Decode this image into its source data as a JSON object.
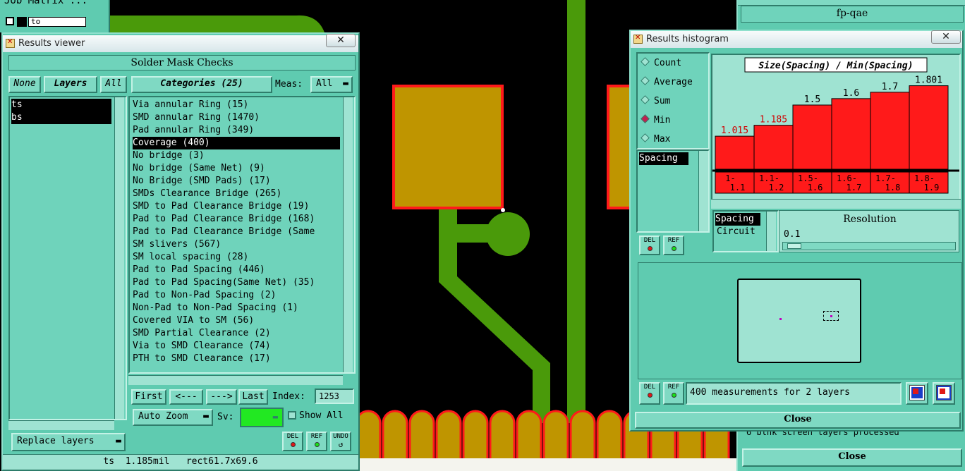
{
  "job_matrix": {
    "title": "Job Matrix ...",
    "layer_value": "to"
  },
  "results_viewer": {
    "title": "Results viewer",
    "section_title": "Solder Mask Checks",
    "filter_buttons": {
      "none": "None",
      "layers": "Layers",
      "all": "All"
    },
    "layers": [
      "ts",
      "bs"
    ],
    "categories_label": "Categories (25)",
    "meas_label": "Meas:",
    "meas_value": "All",
    "categories": [
      "Via annular Ring (15)",
      "SMD annular Ring (1470)",
      "Pad annular Ring (349)",
      "Coverage (400)",
      "No bridge (3)",
      "No bridge (Same Net) (9)",
      "No Bridge (SMD Pads) (17)",
      "SMDs Clearance Bridge (265)",
      "SMD to Pad Clearance Bridge (19)",
      "Pad to Pad Clearance Bridge (168)",
      "Pad to Pad Clearance Bridge (Same",
      "SM slivers (567)",
      "SM local spacing (28)",
      "Pad to Pad Spacing (446)",
      "Pad to Pad Spacing(Same Net) (35)",
      "Pad to Non-Pad Spacing (2)",
      "Non-Pad to Non-Pad Spacing (1)",
      "Covered VIA to SM (56)",
      "SMD Partial Clearance (2)",
      "Via to SMD Clearance (74)",
      "PTH to SMD Clearance (17)"
    ],
    "selected_category": "Coverage (400)",
    "nav": {
      "first": "First",
      "prev": "<---",
      "next": "--->",
      "last": "Last",
      "index_label": "Index:",
      "index_value": "1253"
    },
    "auto_zoom": "Auto Zoom",
    "sv_label": "Sv:",
    "show_all": "Show All",
    "replace_layers": "Replace layers",
    "status": "ts  1.185mil   rect61.7x69.6",
    "small_buttons": [
      "DEL",
      "REF",
      "UNDO"
    ]
  },
  "histogram": {
    "title": "Results histogram",
    "options": [
      "Count",
      "Average",
      "Sum",
      "Min",
      "Max"
    ],
    "selected_option": "Min",
    "list_item": "Spacing",
    "chart_title": "Size(Spacing) / Min(Spacing)",
    "resolution_label": "Resolution",
    "resolution_value": "0.1",
    "type_list": [
      "Spacing",
      "Circuit"
    ],
    "selected_type": "Spacing",
    "summary": "400 measurements for 2 layers",
    "close": "Close",
    "small_buttons": [
      "DEL",
      "REF"
    ]
  },
  "chart_data": {
    "type": "bar",
    "title": "Size(Spacing) / Min(Spacing)",
    "categories": [
      "1-1.1",
      "1.1-1.2",
      "1.5-1.6",
      "1.6-1.7",
      "1.7-1.8",
      "1.8-1.9"
    ],
    "category_lines": [
      [
        "1-",
        "1.1"
      ],
      [
        "1.1-",
        "1.2"
      ],
      [
        "1.5-",
        "1.6"
      ],
      [
        "1.6-",
        "1.7"
      ],
      [
        "1.7-",
        "1.8"
      ],
      [
        "1.8-",
        "1.9"
      ]
    ],
    "values": [
      1.015,
      1.185,
      1.5,
      1.6,
      1.7,
      1.801
    ],
    "value_labels": [
      "1.015",
      "1.185",
      "1.5",
      "1.6",
      "1.7",
      "1.801"
    ],
    "highlight_colors": [
      "#d00000",
      "#d00000",
      "#000000",
      "#000000",
      "#000000",
      "#000000"
    ],
    "bar_color": "#ff1a1a",
    "ylim": [
      0.5,
      1.95
    ]
  },
  "right_panel": {
    "title": "fp-qae",
    "close": "Close",
    "status_text": "6 blnk screen layers processed"
  },
  "colors": {
    "panel": "#5fcbb0",
    "copper": "#bf9500",
    "trace": "#4a9a0a",
    "pad_outline": "#ff1a1a"
  }
}
